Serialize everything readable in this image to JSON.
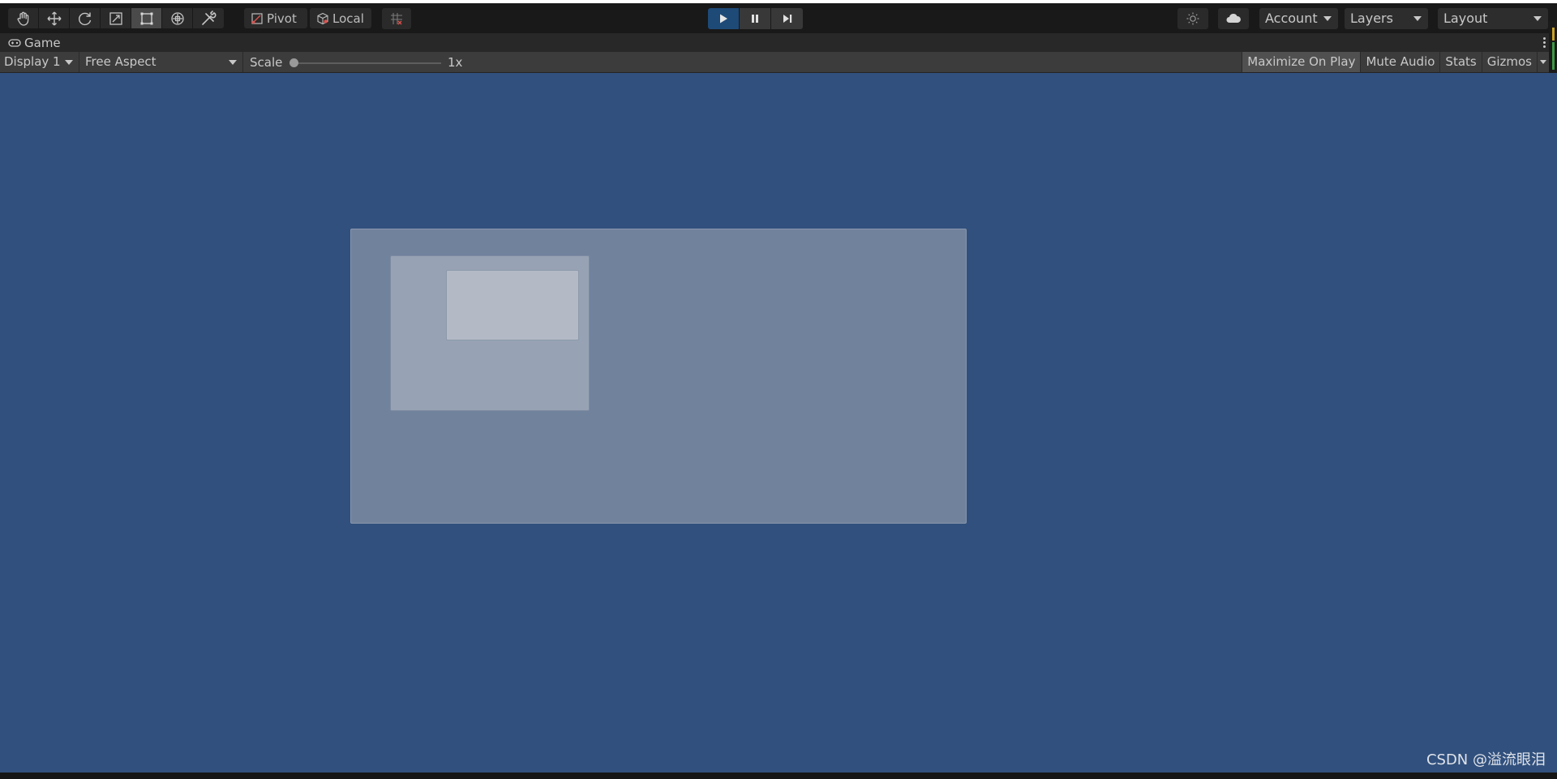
{
  "toolbar": {
    "tools": [
      {
        "name": "hand-tool",
        "icon": "hand-icon",
        "active": false
      },
      {
        "name": "move-tool",
        "icon": "move-icon",
        "active": false
      },
      {
        "name": "rotate-tool",
        "icon": "rotate-icon",
        "active": false
      },
      {
        "name": "scale-tool",
        "icon": "scale-icon",
        "active": false
      },
      {
        "name": "rect-tool",
        "icon": "rect-transform-icon",
        "active": true
      },
      {
        "name": "transform-tool",
        "icon": "transform-icon",
        "active": false
      },
      {
        "name": "custom-tool",
        "icon": "tools-icon",
        "active": false
      }
    ],
    "pivot_label": "Pivot",
    "local_label": "Local",
    "account_label": "Account",
    "layers_label": "Layers",
    "layout_label": "Layout"
  },
  "game_tab": {
    "label": "Game"
  },
  "game_view": {
    "display_label": "Display 1",
    "aspect_label": "Free Aspect",
    "scale_label": "Scale",
    "scale_value": "1x",
    "scale_level": 0,
    "toggles": {
      "maximize_on_play": "Maximize On Play",
      "mute_audio": "Mute Audio",
      "stats": "Stats",
      "gizmos": "Gizmos"
    }
  },
  "watermark": "CSDN @溢流眼泪",
  "colors": {
    "viewport_bg": "#31507d",
    "play_active": "#1e4a78"
  }
}
